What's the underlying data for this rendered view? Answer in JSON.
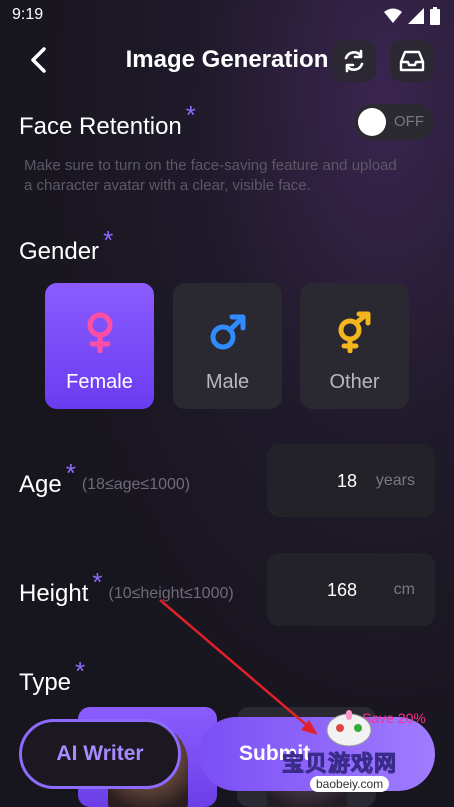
{
  "status": {
    "time": "9:19"
  },
  "header": {
    "title": "Image Generation"
  },
  "face_retention": {
    "label": "Face Retention",
    "required_mark": "*",
    "toggle_text": "OFF",
    "description": "Make sure to turn on the face-saving feature and upload a character avatar with a clear, visible face."
  },
  "gender": {
    "label": "Gender",
    "required_mark": "*",
    "options": [
      {
        "label": "Female",
        "selected": true,
        "color": "#ff4fa3"
      },
      {
        "label": "Male",
        "selected": false,
        "color": "#2f8cff"
      },
      {
        "label": "Other",
        "selected": false,
        "color": "#f5b51c"
      }
    ]
  },
  "age": {
    "label": "Age",
    "required_mark": "*",
    "range_hint": "(18≤age≤1000)",
    "value": "18",
    "unit": "years"
  },
  "height": {
    "label": "Height",
    "required_mark": "*",
    "range_hint": "(10≤height≤1000)",
    "value": "168",
    "unit": "cm"
  },
  "type": {
    "label": "Type",
    "required_mark": "*"
  },
  "bottom": {
    "ai_writer_label": "AI Writer",
    "submit_label": "Submit",
    "save_badge": "Save 20%"
  },
  "watermark": {
    "text": "宝贝游戏网",
    "url": "baobeiy.com"
  },
  "colors": {
    "accent": "#8e6bff",
    "annotation": "#e0202a"
  },
  "icons": [
    "back-arrow-icon",
    "refresh-icon",
    "box-icon",
    "wifi-icon",
    "signal-icon",
    "battery-icon",
    "female-icon",
    "male-icon",
    "other-gender-icon"
  ]
}
